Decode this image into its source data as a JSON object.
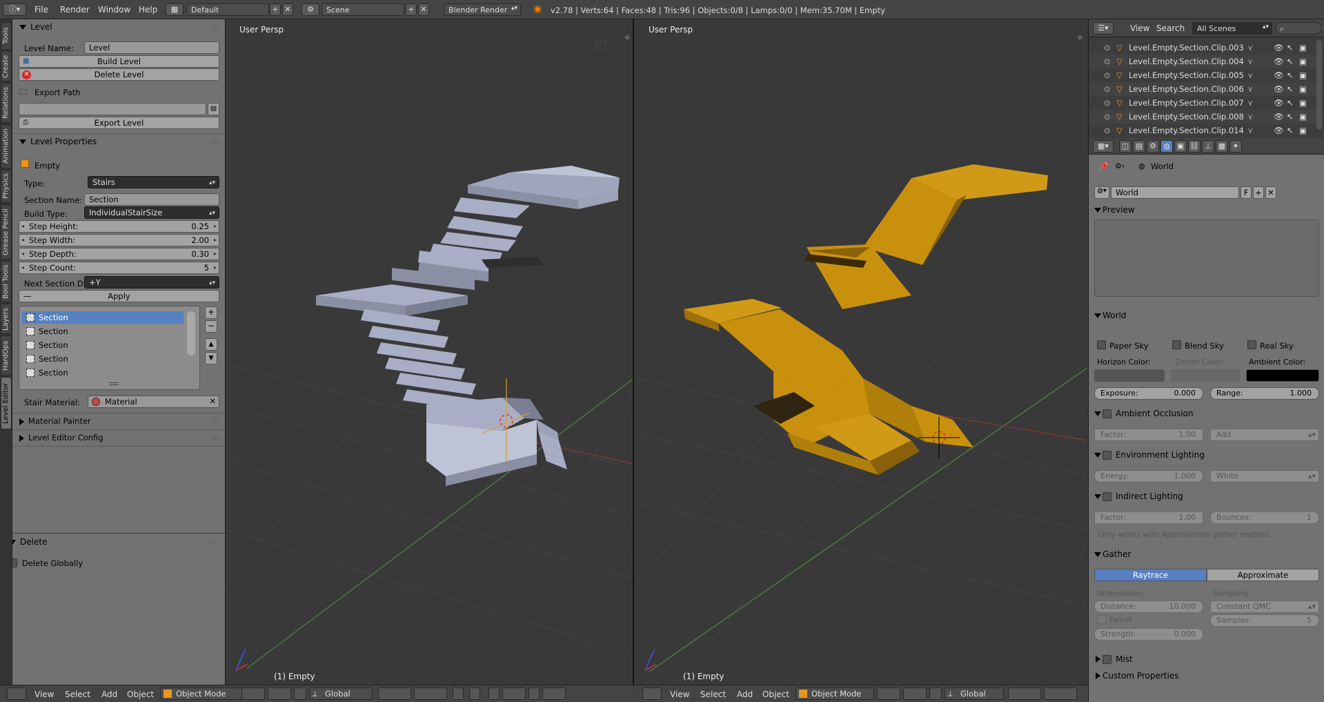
{
  "topbar": {
    "menus": [
      "File",
      "Render",
      "Window",
      "Help"
    ],
    "layout": "Default",
    "scene": "Scene",
    "engine": "Blender Render",
    "stats": "v2.78 | Verts:64 | Faces:48 | Tris:96 | Objects:0/8 | Lamps:0/0 | Mem:35.70M | Empty"
  },
  "tabs": [
    "Tools",
    "Create",
    "Relations",
    "Animation",
    "Physics",
    "Grease Pencil",
    "Bool Tools",
    "Layers",
    "HardOps",
    "Level Editor"
  ],
  "tool_panel": {
    "level_header": "Level",
    "level_name_label": "Level Name:",
    "level_name_value": "Level",
    "build_level": "Build Level",
    "delete_level": "Delete Level",
    "export_path_label": "Export Path",
    "export_path_value": "",
    "export_level": "Export Level",
    "level_props_header": "Level Properties",
    "object_name": "Empty",
    "type_label": "Type:",
    "type_value": "Stairs",
    "section_name_label": "Section Name:",
    "section_name_value": "Section",
    "build_type_label": "Build Type:",
    "build_type_value": "IndividualStairSize",
    "step_height_label": "Step Height:",
    "step_height_value": "0.25",
    "step_width_label": "Step Width:",
    "step_width_value": "2.00",
    "step_depth_label": "Step Depth:",
    "step_depth_value": "0.30",
    "step_count_label": "Step Count:",
    "step_count_value": "5",
    "next_section_label": "Next Section Di...",
    "next_section_value": "+Y",
    "apply": "Apply",
    "sections": [
      "Section",
      "Section",
      "Section",
      "Section",
      "Section"
    ],
    "stair_material_label": "Stair Material:",
    "stair_material_value": "Material",
    "material_painter": "Material Painter",
    "level_editor_config": "Level Editor Config",
    "delete_header": "Delete",
    "delete_globally": "Delete Globally"
  },
  "viewport_left": {
    "label": "User Persp",
    "object": "(1) Empty"
  },
  "viewport_right": {
    "label": "User Persp",
    "object": "(1) Empty"
  },
  "bottom_left": {
    "menus": [
      "View",
      "Select",
      "Add",
      "Object"
    ],
    "mode": "Object Mode",
    "orientation": "Global"
  },
  "bottom_right": {
    "menus": [
      "View",
      "Select",
      "Add",
      "Object"
    ],
    "mode": "Object Mode",
    "orientation": "Global"
  },
  "outliner": {
    "menus": [
      "View",
      "Search"
    ],
    "scenes": "All Scenes",
    "items": [
      "Level.Empty.Section.Clip.003",
      "Level.Empty.Section.Clip.004",
      "Level.Empty.Section.Clip.005",
      "Level.Empty.Section.Clip.006",
      "Level.Empty.Section.Clip.007",
      "Level.Empty.Section.Clip.008",
      "Level.Empty.Section.Clip.014"
    ]
  },
  "properties": {
    "breadcrumb": "World",
    "world_name": "World",
    "world_f": "F",
    "preview": "Preview",
    "world_header": "World",
    "paper_sky": "Paper Sky",
    "blend_sky": "Blend Sky",
    "real_sky": "Real Sky",
    "horizon_color": "Horizon Color:",
    "zenith_color": "Zenith Color:",
    "ambient_color": "Ambient Color:",
    "exposure_label": "Exposure:",
    "exposure_value": "0.000",
    "range_label": "Range:",
    "range_value": "1.000",
    "ao_header": "Ambient Occlusion",
    "ao_factor_label": "Factor:",
    "ao_factor_value": "1.00",
    "ao_mode": "Add",
    "env_header": "Environment Lighting",
    "energy_label": "Energy:",
    "energy_value": "1.000",
    "env_color": "White",
    "indirect_header": "Indirect Lighting",
    "ind_factor_label": "Factor:",
    "ind_factor_value": "1.00",
    "bounces_label": "Bounces:",
    "bounces_value": "1",
    "approx_note": "Only works with Approximate gather method",
    "gather_header": "Gather",
    "raytrace": "Raytrace",
    "approximate": "Approximate",
    "attenuation": "Attenuation:",
    "sampling": "Sampling:",
    "distance_label": "Distance:",
    "distance_value": "10.000",
    "sampling_value": "Constant QMC",
    "falloff": "Falloff",
    "samples_label": "Samples:",
    "samples_value": "5",
    "strength_label": "Strength:",
    "strength_value": "0.000",
    "mist_header": "Mist",
    "custom_props": "Custom Properties"
  },
  "colors": {
    "stairs_grey": "#a9aec6",
    "stairs_orange": "#c8900c",
    "selection": "#5680c2",
    "panel": "#727272",
    "viewport": "#393939"
  }
}
